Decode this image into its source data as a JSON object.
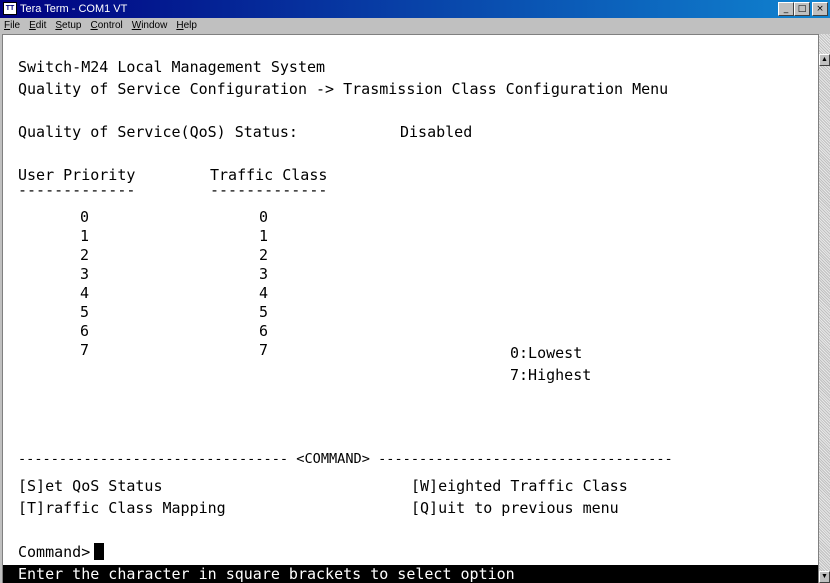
{
  "window": {
    "title": "Tera Term - COM1 VT",
    "buttons": {
      "minimize": "_",
      "maximize": "□",
      "close": "×"
    }
  },
  "menu": [
    "File",
    "Edit",
    "Setup",
    "Control",
    "Window",
    "Help"
  ],
  "screen": {
    "line1": "Switch-M24 Local Management System",
    "line2": "Quality of Service Configuration -> Trasmission Class Configuration Menu",
    "qos_label": "Quality of Service(QoS) Status:",
    "qos_value": "Disabled",
    "header_priority": "User Priority",
    "header_class": "Traffic Class",
    "underline_priority": "-------------",
    "underline_class": "-------------",
    "rows": [
      {
        "priority": "0",
        "class": "0"
      },
      {
        "priority": "1",
        "class": "1"
      },
      {
        "priority": "2",
        "class": "2"
      },
      {
        "priority": "3",
        "class": "3"
      },
      {
        "priority": "4",
        "class": "4"
      },
      {
        "priority": "5",
        "class": "5"
      },
      {
        "priority": "6",
        "class": "6"
      },
      {
        "priority": "7",
        "class": "7"
      }
    ],
    "legend_lowest": "0:Lowest",
    "legend_highest": "7:Highest",
    "command_divider": "--------------------------------- <COMMAND> ------------------------------------",
    "cmd_set_qos": "[S]et QoS Status",
    "cmd_weighted": "[W]eighted Traffic Class",
    "cmd_traffic_map": "[T]raffic Class Mapping",
    "cmd_quit": "[Q]uit to previous menu",
    "prompt": "Command>",
    "status_line": "Enter the character in square brackets to select option"
  }
}
